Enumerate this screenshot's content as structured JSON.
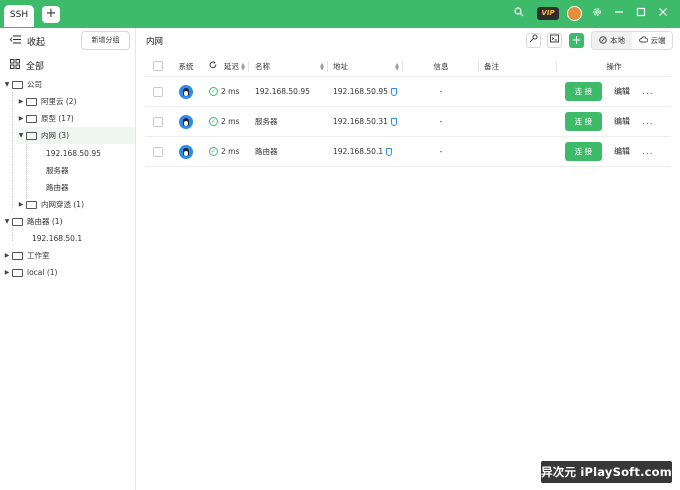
{
  "titlebar": {
    "tab_label": "SSH",
    "add_tab_symbol": "+",
    "vip_label": "VIP",
    "brand_color": "#3dbb6a"
  },
  "sidebar": {
    "collapse_label": "收起",
    "new_group_label": "新增分组",
    "all_label": "全部",
    "tree": [
      {
        "label": "公司"
      },
      {
        "label": "阿里云 (2)"
      },
      {
        "label": "原型 (17)"
      },
      {
        "label": "内网 (3)"
      },
      {
        "label": "192.168.50.95"
      },
      {
        "label": "服务器"
      },
      {
        "label": "路由器"
      },
      {
        "label": "内网穿透 (1)"
      },
      {
        "label": "路由器 (1)"
      },
      {
        "label": "192.168.50.1"
      },
      {
        "label": "工作室"
      },
      {
        "label": "local (1)"
      }
    ]
  },
  "main": {
    "breadcrumb": "内网",
    "segment": {
      "local_label": "本地",
      "cloud_label": "云端"
    },
    "table": {
      "headers": {
        "os": "系统",
        "delay": "延迟",
        "name": "名称",
        "address": "地址",
        "info": "信息",
        "note": "备注",
        "ops": "操作"
      },
      "rows": [
        {
          "delay": "2 ms",
          "name": "192.168.50.95",
          "address": "192.168.50.95",
          "info": "-",
          "note": "",
          "connect": "连 接",
          "edit": "编辑",
          "more": "..."
        },
        {
          "delay": "2 ms",
          "name": "服务器",
          "address": "192.168.50.31",
          "info": "-",
          "note": "",
          "connect": "连 接",
          "edit": "编辑",
          "more": "..."
        },
        {
          "delay": "2 ms",
          "name": "路由器",
          "address": "192.168.50.1",
          "info": "-",
          "note": "",
          "connect": "连 接",
          "edit": "编辑",
          "more": "..."
        }
      ]
    }
  },
  "watermark": "异次元 iPlaySoft.com"
}
